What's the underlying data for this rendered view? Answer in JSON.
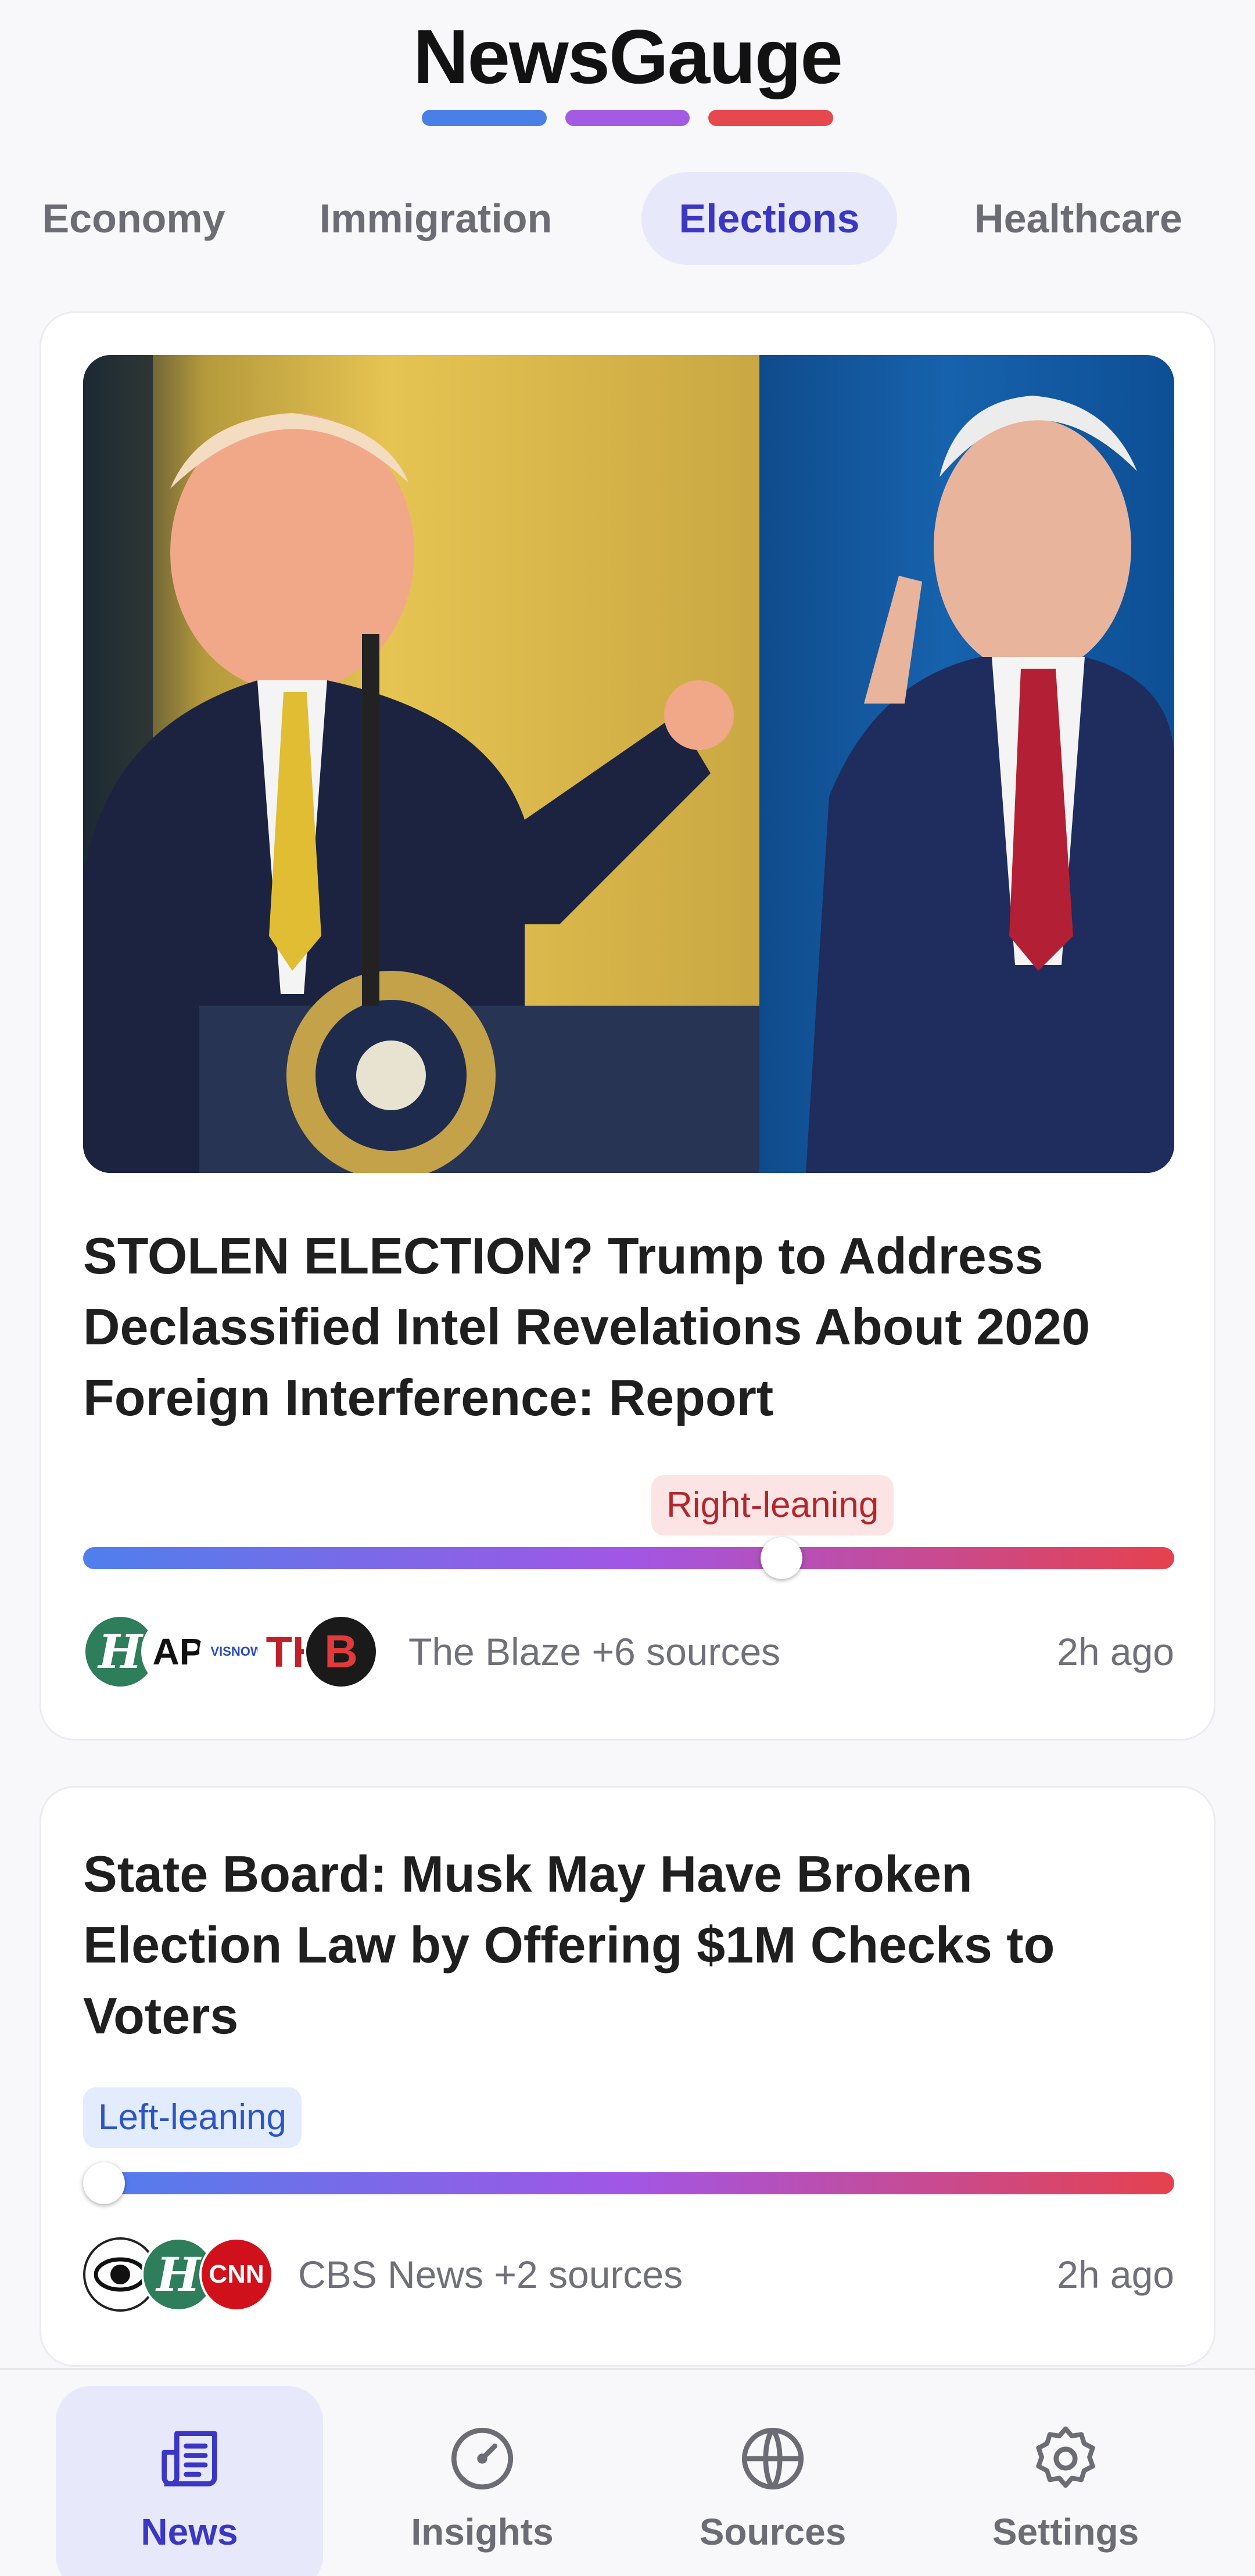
{
  "app": {
    "title": "NewsGauge",
    "accent_colors": [
      "#4a7fe6",
      "#a45be3",
      "#e5484d"
    ]
  },
  "tabs": [
    {
      "label": "Economy",
      "active": false
    },
    {
      "label": "Immigration",
      "active": false
    },
    {
      "label": "Elections",
      "active": true
    },
    {
      "label": "Healthcare",
      "active": false
    }
  ],
  "articles": [
    {
      "headline": "STOLEN ELECTION? Trump to Address Declassified Intel Revelations About 2020 Foreign Interference: Report",
      "lean": "Right-leaning",
      "bias_position": 0.64,
      "sources_text": "The Blaze +6 sources",
      "time": "2h ago",
      "source_logos": [
        "HuffPost",
        "AP",
        "VIS NOW",
        "TH",
        "The Blaze"
      ],
      "image_icon": "news-photo"
    },
    {
      "headline": "State Board: Musk May Have Broken Election Law by Offering $1M Checks to Voters",
      "lean": "Left-leaning",
      "bias_position": 0.0,
      "sources_text": "CBS News +2 sources",
      "time": "2h ago",
      "source_logos": [
        "CBS",
        "HuffPost",
        "CNN"
      ]
    }
  ],
  "bottom_nav": [
    {
      "label": "News",
      "icon": "newspaper-icon",
      "active": true
    },
    {
      "label": "Insights",
      "icon": "gauge-icon",
      "active": false
    },
    {
      "label": "Sources",
      "icon": "globe-icon",
      "active": false
    },
    {
      "label": "Settings",
      "icon": "gear-icon",
      "active": false
    }
  ]
}
